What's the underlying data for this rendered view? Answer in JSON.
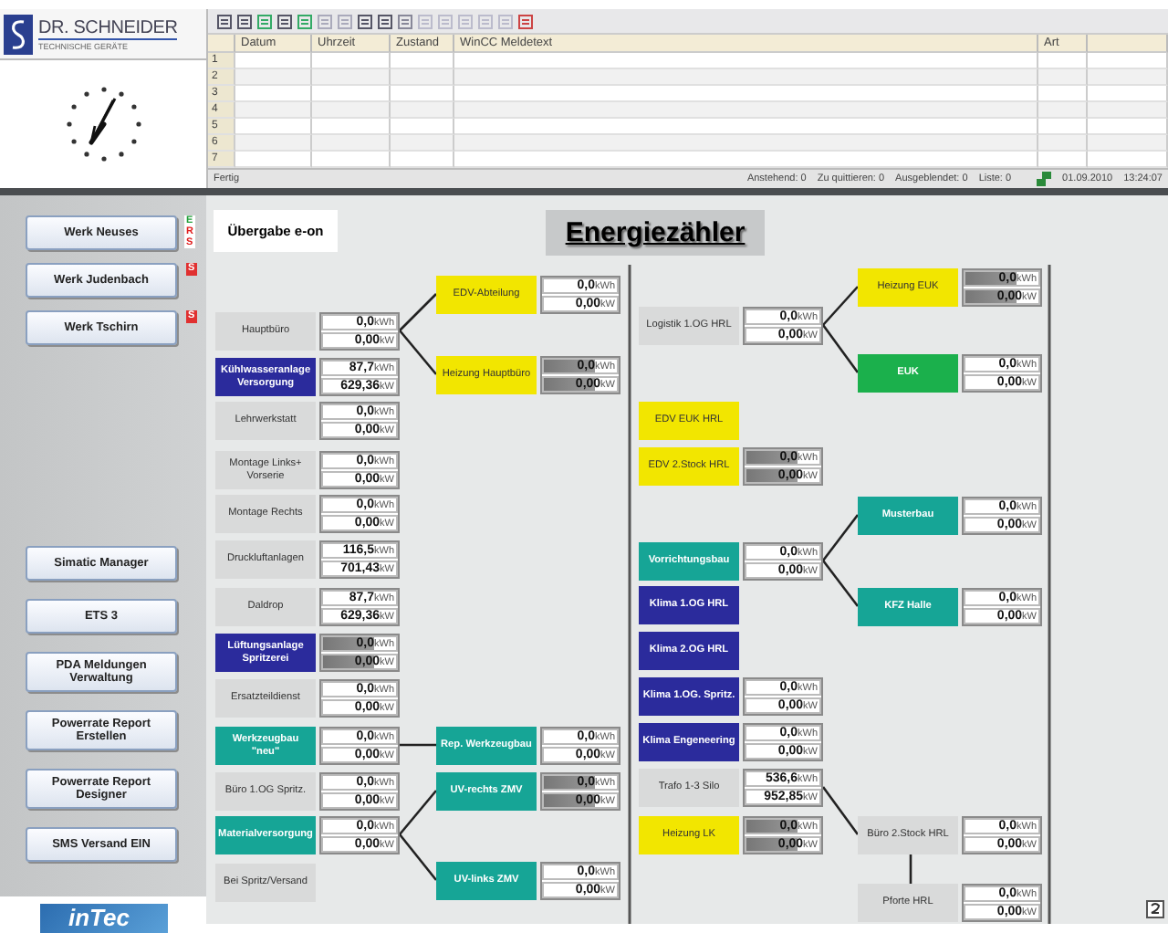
{
  "logo": {
    "name": "DR. SCHNEIDER",
    "tagline": "TECHNISCHE GERÄTE"
  },
  "alarm_list": {
    "columns": [
      "Datum",
      "Uhrzeit",
      "Zustand",
      "WinCC Meldetext",
      "Art"
    ],
    "rows": [
      "1",
      "2",
      "3",
      "4",
      "5",
      "6",
      "7"
    ],
    "status_bar": {
      "state": "Fertig",
      "counters": [
        "Anstehend: 0",
        "Zu quittieren: 0",
        "Ausgeblendet: 0",
        "Liste: 0"
      ],
      "date": "01.09.2010",
      "time": "13:24:07"
    }
  },
  "sidebar": {
    "plant_buttons": [
      {
        "label": "Werk Neuses",
        "badges": [
          {
            "text": "E",
            "color": "#22a03a",
            "kind": "letter"
          },
          {
            "text": "R",
            "color": "#e02020",
            "kind": "letter"
          },
          {
            "text": "S",
            "color": "#e02020",
            "kind": "letter"
          }
        ]
      },
      {
        "label": "Werk Judenbach",
        "badges": [
          {
            "text": "S",
            "color": "#e03030",
            "kind": "tag"
          }
        ]
      },
      {
        "label": "Werk Tschirn",
        "badges": [
          {
            "text": "S",
            "color": "#e03030",
            "kind": "tag"
          }
        ]
      }
    ],
    "tool_buttons": [
      "Simatic Manager",
      "ETS 3",
      "PDA Meldungen Verwaltung",
      "Powerrate Report Erstellen",
      "Powerrate Report Designer",
      "SMS Versand EIN"
    ],
    "brand": "inTec"
  },
  "diagram": {
    "handover": "Übergabe e-on",
    "title": "Energiezähler",
    "columns": [
      {
        "nodes": [
          {
            "label": "Hauptbüro",
            "color": "#d9dada",
            "meter": {
              "energy": "0,0",
              "energy_unit": "kWh",
              "power": "0,00",
              "power_unit": "kW",
              "inactive": false
            }
          },
          {
            "label": "Kühlwasseranlage Versorgung",
            "color": "#2b2b9c",
            "meter": {
              "energy": "87,7",
              "energy_unit": "kWh",
              "power": "629,36",
              "power_unit": "kW",
              "inactive": false
            }
          },
          {
            "label": "Lehrwerkstatt",
            "color": "#d9dada",
            "meter": {
              "energy": "0,0",
              "energy_unit": "kWh",
              "power": "0,00",
              "power_unit": "kW",
              "inactive": false
            }
          },
          {
            "label": "Montage Links+ Vorserie",
            "color": "#d9dada",
            "meter": {
              "energy": "0,0",
              "energy_unit": "kWh",
              "power": "0,00",
              "power_unit": "kW",
              "inactive": false
            }
          },
          {
            "label": "Montage Rechts",
            "color": "#d9dada",
            "meter": {
              "energy": "0,0",
              "energy_unit": "kWh",
              "power": "0,00",
              "power_unit": "kW",
              "inactive": false
            }
          },
          {
            "label": "Druckluftanlagen",
            "color": "#d9dada",
            "meter": {
              "energy": "116,5",
              "energy_unit": "kWh",
              "power": "701,43",
              "power_unit": "kW",
              "inactive": false
            }
          },
          {
            "label": "Daldrop",
            "color": "#d9dada",
            "meter": {
              "energy": "87,7",
              "energy_unit": "kWh",
              "power": "629,36",
              "power_unit": "kW",
              "inactive": false
            }
          },
          {
            "label": "Lüftungsanlage Spritzerei",
            "color": "#2b2b9c",
            "meter": {
              "energy": "0,0",
              "energy_unit": "kWh",
              "power": "0,00",
              "power_unit": "kW",
              "inactive": true
            }
          },
          {
            "label": "Ersatzteildienst",
            "color": "#d9dada",
            "meter": {
              "energy": "0,0",
              "energy_unit": "kWh",
              "power": "0,00",
              "power_unit": "kW",
              "inactive": false
            }
          },
          {
            "label": "Werkzeugbau \"neu\"",
            "color": "#16a596",
            "meter": {
              "energy": "0,0",
              "energy_unit": "kWh",
              "power": "0,00",
              "power_unit": "kW",
              "inactive": false
            }
          },
          {
            "label": "Büro 1.OG Spritz.",
            "color": "#d9dada",
            "meter": {
              "energy": "0,0",
              "energy_unit": "kWh",
              "power": "0,00",
              "power_unit": "kW",
              "inactive": false
            }
          },
          {
            "label": "Materialversorgung",
            "color": "#16a596",
            "meter": {
              "energy": "0,0",
              "energy_unit": "kWh",
              "power": "0,00",
              "power_unit": "kW",
              "inactive": false
            }
          },
          {
            "label": "Bei Spritz/Versand",
            "color": "#d9dada"
          }
        ]
      },
      {
        "nodes": [
          {
            "label": "EDV-Abteilung",
            "color": "#f2e600",
            "meter": {
              "energy": "0,0",
              "energy_unit": "kWh",
              "power": "0,00",
              "power_unit": "kW",
              "inactive": false
            }
          },
          {
            "label": "Heizung Hauptbüro",
            "color": "#f2e600",
            "meter": {
              "energy": "0,0",
              "energy_unit": "kWh",
              "power": "0,00",
              "power_unit": "kW",
              "inactive": true
            }
          },
          {
            "label": "Rep. Werkzeugbau",
            "color": "#16a596",
            "meter": {
              "energy": "0,0",
              "energy_unit": "kWh",
              "power": "0,00",
              "power_unit": "kW",
              "inactive": false
            }
          },
          {
            "label": "UV-rechts ZMV",
            "color": "#16a596",
            "meter": {
              "energy": "0,0",
              "energy_unit": "kWh",
              "power": "0,00",
              "power_unit": "kW",
              "inactive": true
            }
          },
          {
            "label": "UV-links ZMV",
            "color": "#16a596",
            "meter": {
              "energy": "0,0",
              "energy_unit": "kWh",
              "power": "0,00",
              "power_unit": "kW",
              "inactive": false
            }
          }
        ]
      },
      {
        "nodes": [
          {
            "label": "Logistik 1.OG HRL",
            "color": "#d9dada",
            "meter": {
              "energy": "0,0",
              "energy_unit": "kWh",
              "power": "0,00",
              "power_unit": "kW",
              "inactive": false
            }
          },
          {
            "label": "EDV EUK HRL",
            "color": "#f2e600"
          },
          {
            "label": "EDV 2.Stock HRL",
            "color": "#f2e600",
            "meter": {
              "energy": "0,0",
              "energy_unit": "kWh",
              "power": "0,00",
              "power_unit": "kW",
              "inactive": true
            }
          },
          {
            "label": "Vorrichtungsbau",
            "color": "#16a596",
            "meter": {
              "energy": "0,0",
              "energy_unit": "kWh",
              "power": "0,00",
              "power_unit": "kW",
              "inactive": false
            }
          },
          {
            "label": "Klima 1.OG HRL",
            "color": "#2b2b9c"
          },
          {
            "label": "Klima 2.OG HRL",
            "color": "#2b2b9c"
          },
          {
            "label": "Klima 1.OG. Spritz.",
            "color": "#2b2b9c",
            "meter": {
              "energy": "0,0",
              "energy_unit": "kWh",
              "power": "0,00",
              "power_unit": "kW",
              "inactive": false
            }
          },
          {
            "label": "Klima Engeneering",
            "color": "#2b2b9c",
            "meter": {
              "energy": "0,0",
              "energy_unit": "kWh",
              "power": "0,00",
              "power_unit": "kW",
              "inactive": false
            }
          },
          {
            "label": "Trafo 1-3 Silo",
            "color": "#d9dada",
            "meter": {
              "energy": "536,6",
              "energy_unit": "kWh",
              "power": "952,85",
              "power_unit": "kW",
              "inactive": false
            }
          },
          {
            "label": "Heizung LK",
            "color": "#f2e600",
            "meter": {
              "energy": "0,0",
              "energy_unit": "kWh",
              "power": "0,00",
              "power_unit": "kW",
              "inactive": true
            }
          }
        ]
      },
      {
        "nodes": [
          {
            "label": "Heizung EUK",
            "color": "#f2e600",
            "meter": {
              "energy": "0,0",
              "energy_unit": "kWh",
              "power": "0,00",
              "power_unit": "kW",
              "inactive": true
            }
          },
          {
            "label": "EUK",
            "color": "#1bb04c",
            "meter": {
              "energy": "0,0",
              "energy_unit": "kWh",
              "power": "0,00",
              "power_unit": "kW",
              "inactive": false
            }
          },
          {
            "label": "Musterbau",
            "color": "#16a596",
            "meter": {
              "energy": "0,0",
              "energy_unit": "kWh",
              "power": "0,00",
              "power_unit": "kW",
              "inactive": false
            }
          },
          {
            "label": "KFZ Halle",
            "color": "#16a596",
            "meter": {
              "energy": "0,0",
              "energy_unit": "kWh",
              "power": "0,00",
              "power_unit": "kW",
              "inactive": false
            }
          },
          {
            "label": "Büro 2.Stock HRL",
            "color": "#d9dada",
            "meter": {
              "energy": "0,0",
              "energy_unit": "kWh",
              "power": "0,00",
              "power_unit": "kW",
              "inactive": false
            }
          },
          {
            "label": "Pforte HRL",
            "color": "#d9dada",
            "meter": {
              "energy": "0,0",
              "energy_unit": "kWh",
              "power": "0,00",
              "power_unit": "kW",
              "inactive": false
            }
          }
        ]
      }
    ]
  }
}
